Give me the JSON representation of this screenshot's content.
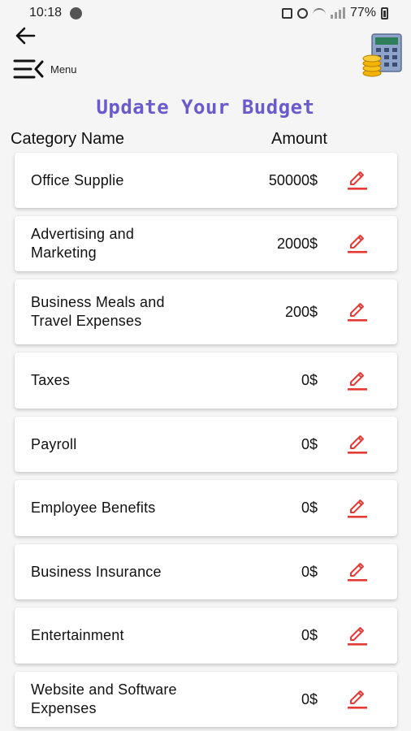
{
  "status_bar": {
    "time": "10:18",
    "battery": "77%"
  },
  "header": {
    "menu_label": "Menu"
  },
  "title": "Update Your Budget",
  "columns": {
    "name": "Category Name",
    "amount": "Amount"
  },
  "colors": {
    "title": "#6a5acd",
    "edit_icon": "#e53935"
  },
  "categories": [
    {
      "name": "Office Supplie",
      "amount": "50000$"
    },
    {
      "name": "Advertising and Marketing",
      "amount": "2000$"
    },
    {
      "name": "Business Meals and Travel Expenses",
      "amount": "200$"
    },
    {
      "name": "Taxes",
      "amount": "0$"
    },
    {
      "name": "Payroll",
      "amount": "0$"
    },
    {
      "name": "Employee Benefits",
      "amount": "0$"
    },
    {
      "name": "Business Insurance",
      "amount": "0$"
    },
    {
      "name": "Entertainment",
      "amount": "0$"
    },
    {
      "name": "Website and Software Expenses",
      "amount": "0$"
    }
  ]
}
